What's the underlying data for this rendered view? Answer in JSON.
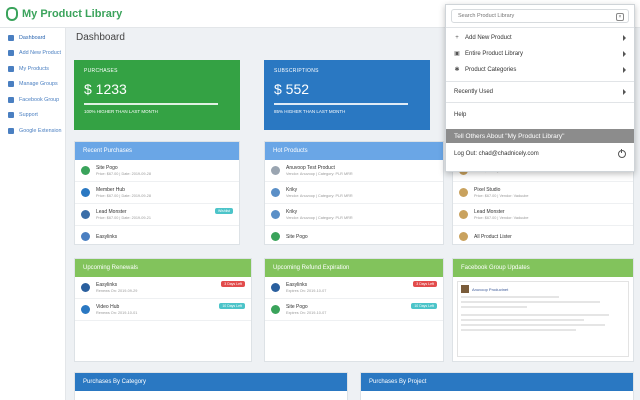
{
  "app": {
    "title": "My Product Library"
  },
  "sidebar": {
    "items": [
      {
        "label": "Dashboard"
      },
      {
        "label": "Add New Product"
      },
      {
        "label": "My Products"
      },
      {
        "label": "Manage Groups"
      },
      {
        "label": "Facebook Group"
      },
      {
        "label": "Support"
      },
      {
        "label": "Google Extension"
      }
    ]
  },
  "page": {
    "title": "Dashboard"
  },
  "stats": {
    "purchases": {
      "label": "PURCHASES",
      "value": "$ 1233",
      "sub": "100% HIGHER THAN LAST MONTH"
    },
    "subscriptions": {
      "label": "SUBSCRIPTIONS",
      "value": "$ 552",
      "sub": "85% HIGHER THAN LAST MONTH"
    }
  },
  "recent_purchases": {
    "title": "Recent Purchases",
    "rows": [
      {
        "name": "Site Pogo",
        "meta": "Price: $67.00 | Date: 2019-09-28"
      },
      {
        "name": "Member Hub",
        "meta": "Price: $67.00 | Date: 2019-09-28"
      },
      {
        "name": "Lead Monster",
        "meta": "Price: $67.00 | Date: 2019-09-21",
        "badge": "Wishlist"
      },
      {
        "name": "Easylinks",
        "meta": ""
      }
    ]
  },
  "hot_products": {
    "title": "Hot Products",
    "rows": [
      {
        "name": "Anuvoop Test Product",
        "meta": "Vendor: Anuvoop | Category: PLR MRR"
      },
      {
        "name": "Kriky",
        "meta": "Vendor: Anuvoop | Category: PLR MRR"
      },
      {
        "name": "Kriky",
        "meta": "Vendor: Anuvoop | Category: PLR MRR"
      },
      {
        "name": "Site Pogo",
        "meta": ""
      }
    ]
  },
  "right_list": {
    "rows": [
      {
        "name": "",
        "meta": "Price: $75.00 | Vendor: Vaduube"
      },
      {
        "name": "Pixel Studio",
        "meta": "Price: $67.00 | Vendor: Vaduube"
      },
      {
        "name": "Lead Monster",
        "meta": "Price: $67.00 | Vendor: Vaduube"
      },
      {
        "name": "All Product Lister",
        "meta": ""
      }
    ]
  },
  "upcoming_renewals": {
    "title": "Upcoming Renewals",
    "rows": [
      {
        "name": "Easylinks",
        "meta": "Renews On: 2019-09-29",
        "badge": "3 Days Left"
      },
      {
        "name": "Video Hub",
        "meta": "Renews On: 2019-10-01",
        "badge": "10 Days Left"
      }
    ]
  },
  "refund_expiration": {
    "title": "Upcoming Refund Expiration",
    "rows": [
      {
        "name": "Easylinks",
        "meta": "Expires On: 2019-10-07",
        "badge": "3 Days Left"
      },
      {
        "name": "Site Pogo",
        "meta": "Expires On: 2019-10-07",
        "badge": "10 Days Left"
      }
    ]
  },
  "facebook_updates": {
    "title": "Facebook Group Updates",
    "author": "Anuvoop Productnet"
  },
  "bottom_panels": {
    "by_category": "Purchases By Category",
    "by_project": "Purchases By Project"
  },
  "dropdown": {
    "search_placeholder": "Search Product Library",
    "items": [
      {
        "label": "Add New Product"
      },
      {
        "label": "Entire Product Library"
      },
      {
        "label": "Product Categories"
      }
    ],
    "recently_used": "Recently Used",
    "help": "Help",
    "tell_others": "Tell Others About \"My Product Library\"",
    "logout": "Log Out: chad@chadnicely.com"
  },
  "colors": {
    "green": "#34a244",
    "blue": "#2a78c2",
    "light_blue": "#6aa6e6",
    "light_green": "#82c35c"
  }
}
